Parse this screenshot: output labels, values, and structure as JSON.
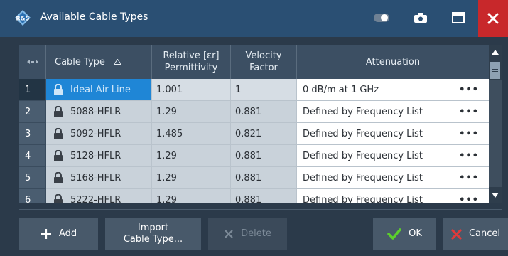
{
  "window": {
    "title": "Available Cable Types",
    "accent_color": "#2a4f73",
    "close_color": "#c8282b",
    "icons": [
      "toggle-icon",
      "camera-icon",
      "maximize-icon",
      "close-icon"
    ]
  },
  "table": {
    "headers": {
      "index": "",
      "cable_type": "Cable Type",
      "permittivity_line1": "Relative [εr]",
      "permittivity_line2": "Permittivity",
      "velocity_line1": "Velocity",
      "velocity_line2": "Factor",
      "attenuation": "Attenuation"
    },
    "selected_color": "#1f86d6",
    "rows": [
      {
        "index": "1",
        "type": "Ideal Air Line",
        "permittivity": "1.001",
        "velocity": "1",
        "attenuation": "0 dB/m at 1 GHz",
        "more": "•••"
      },
      {
        "index": "2",
        "type": "5088-HFLR",
        "permittivity": "1.29",
        "velocity": "0.881",
        "attenuation": "Defined by Frequency List",
        "more": "•••"
      },
      {
        "index": "3",
        "type": "5092-HFLR",
        "permittivity": "1.485",
        "velocity": "0.821",
        "attenuation": "Defined by Frequency List",
        "more": "•••"
      },
      {
        "index": "4",
        "type": "5128-HFLR",
        "permittivity": "1.29",
        "velocity": "0.881",
        "attenuation": "Defined by Frequency List",
        "more": "•••"
      },
      {
        "index": "5",
        "type": "5168-HFLR",
        "permittivity": "1.29",
        "velocity": "0.881",
        "attenuation": "Defined by Frequency List",
        "more": "•••"
      },
      {
        "index": "6",
        "type": "5222-HFLR",
        "permittivity": "1.29",
        "velocity": "0.881",
        "attenuation": "Defined by Frequency List",
        "more": "•••"
      }
    ]
  },
  "buttons": {
    "add": "Add",
    "import_line1": "Import",
    "import_line2": "Cable Type...",
    "delete": "Delete",
    "ok": "OK",
    "cancel": "Cancel"
  }
}
